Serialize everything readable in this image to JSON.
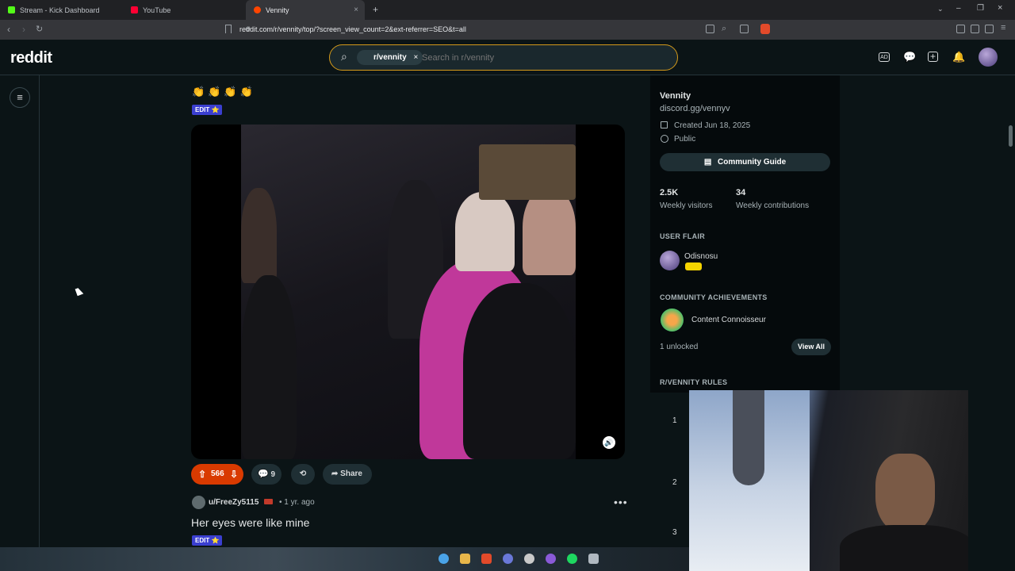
{
  "browser": {
    "tabs": [
      {
        "label": "Stream - Kick Dashboard",
        "favicon_color": "#53fc18"
      },
      {
        "label": "YouTube",
        "favicon_color": "#ff0033"
      },
      {
        "label": "Vennity",
        "favicon_color": "#ff4500"
      }
    ],
    "url": "reddit.com/r/vennity/top/?screen_view_count=2&ext-referrer=SEO&t=all",
    "back_icon": "‹",
    "forward_icon": "›",
    "reload_icon": "↻",
    "new_tab_icon": "+",
    "tab_close_icon": "×"
  },
  "header": {
    "logo": "reddit",
    "search_chip": "r/vennity",
    "search_chip_close": "×",
    "search_placeholder": "Search in r/vennity",
    "search_icon": "⌕",
    "icons": [
      "ad-icon",
      "chat-icon",
      "create-icon",
      "notifications-icon",
      "avatar"
    ]
  },
  "post1": {
    "emojis": "👏👏👏👏",
    "flair": "EDIT ⭐",
    "votes": "566",
    "comments": "9",
    "share_label": "Share"
  },
  "post2": {
    "author": "u/FreeZy5115",
    "age": "• 1 yr. ago",
    "title": "Her eyes were like mine",
    "flair": "EDIT ⭐",
    "more": "•••"
  },
  "sidebar": {
    "community_name": "Vennity",
    "community_link": "discord.gg/vennyv",
    "created": "Created Jun 18, 2025",
    "visibility": "Public",
    "guide_label": "Community Guide",
    "weekly_visitors_value": "2.5K",
    "weekly_visitors_label": "Weekly visitors",
    "weekly_contrib_value": "34",
    "weekly_contrib_label": "Weekly contributions",
    "user_flair_heading": "USER FLAIR",
    "user_flair_name": "Odisnosu",
    "achievements_heading": "COMMUNITY ACHIEVEMENTS",
    "achievement_name": "Content Connoisseur",
    "unlocked": "1 unlocked",
    "view_all": "View All",
    "rules_heading": "R/VENNITY RULES",
    "rules": [
      "1",
      "2",
      "3"
    ]
  },
  "colors": {
    "accent_upvote": "#d93a00",
    "flair_blue": "#3b3fd0",
    "search_border": "#d49a1a"
  }
}
